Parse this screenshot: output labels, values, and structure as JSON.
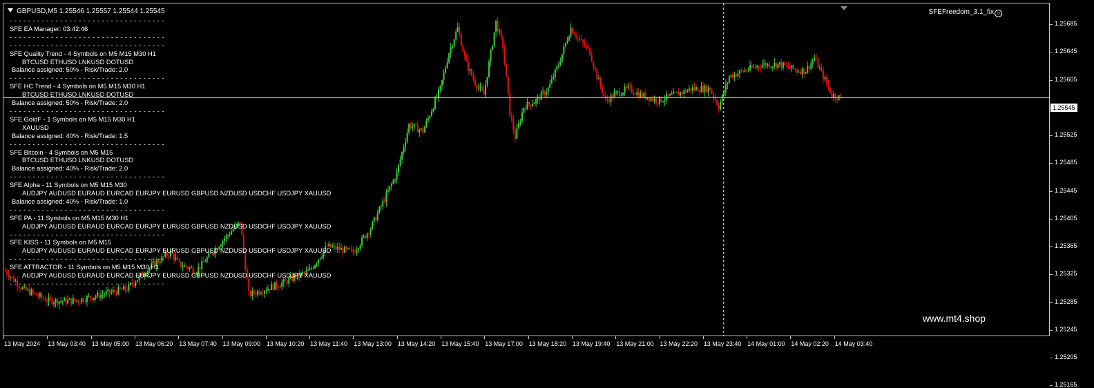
{
  "header": {
    "symbol_line": "GBPUSD,M5  1.25546 1.25557 1.25544 1.25545",
    "ea_title": "SFEFreedom_3.1_fix",
    "smile_glyph": "☺"
  },
  "panel": {
    "separator": "- - - - - - - - - - - - - - - - - - - - - - - - - - - - - - - - - -",
    "manager": "SFE EA Manager: 03:42:46",
    "strategies": [
      {
        "title": "SFE Quality Trend - 4 Symbols on M5 M15 M30 H1",
        "symbols": "BTCUSD ETHUSD LNKUSD DOTUSD",
        "balance": "Balance assigned: 50% -  Risk/Trade: 2.0"
      },
      {
        "title": "SFE HC Trend - 4 Symbols on M5 M15 M30 H1",
        "symbols": "BTCUSD ETHUSD LNKUSD DOTUSD",
        "balance": "Balance assigned: 50% -  Risk/Trade: 2.0"
      },
      {
        "title": "SFE GoldF - 1 Symbols on M5 M15 M30 H1",
        "symbols": "XAUUSD",
        "balance": "Balance assigned: 40% -  Risk/Trade: 1.5"
      },
      {
        "title": "SFE Bitcoin - 4 Symbols on M5 M15",
        "symbols": "BTCUSD ETHUSD LNKUSD DOTUSD",
        "balance": "Balance assigned: 40% -  Risk/Trade: 2.0"
      },
      {
        "title": "SFE Alpha - 11 Symbols on M5 M15 M30",
        "symbols": "AUDJPY AUDUSD EURAUD EURCAD EURJPY EURUSD GBPUSD NZDUSD USDCHF USDJPY XAUUSD",
        "balance": "Balance assigned: 40% -  Risk/Trade: 1.0"
      },
      {
        "title": "SFE PA - 11 Symbols on M5 M15 M30 H1",
        "symbols": "AUDJPY AUDUSD EURAUD EURCAD EURJPY EURUSD GBPUSD NZDUSD USDCHF USDJPY XAUUSD",
        "balance": ""
      },
      {
        "title": "SFE KISS - 11 Symbols on M5 M15",
        "symbols": "AUDJPY AUDUSD EURAUD EURCAD EURJPY EURUSD GBPUSD NZDUSD USDCHF USDJPY XAUUSD",
        "balance": ""
      },
      {
        "title": "SFE ATTRACTOR - 11 Symbols on M5 M15 M30 H1",
        "symbols": "AUDJPY AUDUSD EURAUD EURCAD EURJPY EURUSD GBPUSD NZDUSD USDCHF USDJPY XAUUSD",
        "balance": ""
      }
    ]
  },
  "watermark": "www.mt4.shop",
  "price_axis": {
    "labels": [
      "1.25685",
      "1.25645",
      "1.25605",
      "1.25565",
      "1.25525",
      "1.25485",
      "1.25445",
      "1.25405",
      "1.25365",
      "1.25325",
      "1.25285",
      "1.25245",
      "1.25205",
      "1.25165"
    ],
    "current_price": "1.25545"
  },
  "time_axis": {
    "labels": [
      "13 May 2024",
      "13 May 03:40",
      "13 May 05:00",
      "13 May 06:20",
      "13 May 07:40",
      "13 May 09:00",
      "13 May 10:20",
      "13 May 11:40",
      "13 May 13:00",
      "13 May 14:20",
      "13 May 15:40",
      "13 May 17:00",
      "13 May 18:20",
      "13 May 19:40",
      "13 May 21:00",
      "13 May 22:20",
      "13 May 23:40",
      "14 May 01:00",
      "14 May 02:20",
      "14 May 03:40"
    ]
  },
  "colors": {
    "bull": "#39d139",
    "bear": "#ee1111",
    "background": "#000000",
    "grid": "#c8c8c8"
  },
  "chart_data": {
    "type": "candlestick",
    "symbol": "GBPUSD",
    "timeframe": "M5",
    "ylim": [
      1.25155,
      1.25705
    ],
    "current_price": 1.25545,
    "close_path_anchors": [
      [
        0,
        1.2526
      ],
      [
        10,
        1.2523
      ],
      [
        25,
        1.2521
      ],
      [
        40,
        1.2521
      ],
      [
        55,
        1.2522
      ],
      [
        70,
        1.2523
      ],
      [
        85,
        1.2527
      ],
      [
        95,
        1.2529
      ],
      [
        100,
        1.2527
      ],
      [
        110,
        1.2526
      ],
      [
        125,
        1.2531
      ],
      [
        135,
        1.2534
      ],
      [
        140,
        1.2522
      ],
      [
        160,
        1.2524
      ],
      [
        175,
        1.2526
      ],
      [
        185,
        1.253
      ],
      [
        200,
        1.2529
      ],
      [
        210,
        1.2533
      ],
      [
        225,
        1.2542
      ],
      [
        232,
        1.255
      ],
      [
        240,
        1.2549
      ],
      [
        250,
        1.2556
      ],
      [
        255,
        1.2562
      ],
      [
        260,
        1.2566
      ],
      [
        265,
        1.256
      ],
      [
        270,
        1.2557
      ],
      [
        275,
        1.2555
      ],
      [
        282,
        1.2567
      ],
      [
        286,
        1.2563
      ],
      [
        290,
        1.2552
      ],
      [
        293,
        1.2548
      ],
      [
        298,
        1.2553
      ],
      [
        305,
        1.2554
      ],
      [
        312,
        1.2556
      ],
      [
        318,
        1.256
      ],
      [
        325,
        1.2566
      ],
      [
        330,
        1.2564
      ],
      [
        336,
        1.2562
      ],
      [
        340,
        1.2558
      ],
      [
        345,
        1.2554
      ],
      [
        350,
        1.2555
      ],
      [
        358,
        1.2556
      ],
      [
        365,
        1.2555
      ],
      [
        375,
        1.2554
      ],
      [
        385,
        1.2555
      ],
      [
        395,
        1.2556
      ],
      [
        405,
        1.2556
      ],
      [
        410,
        1.2553
      ],
      [
        416,
        1.2558
      ],
      [
        425,
        1.2559
      ],
      [
        435,
        1.256
      ],
      [
        445,
        1.256
      ],
      [
        455,
        1.2559
      ],
      [
        460,
        1.2559
      ],
      [
        465,
        1.2561
      ],
      [
        470,
        1.2558
      ],
      [
        475,
        1.2555
      ],
      [
        480,
        1.25545
      ]
    ],
    "crosshair_time_index": 413
  }
}
